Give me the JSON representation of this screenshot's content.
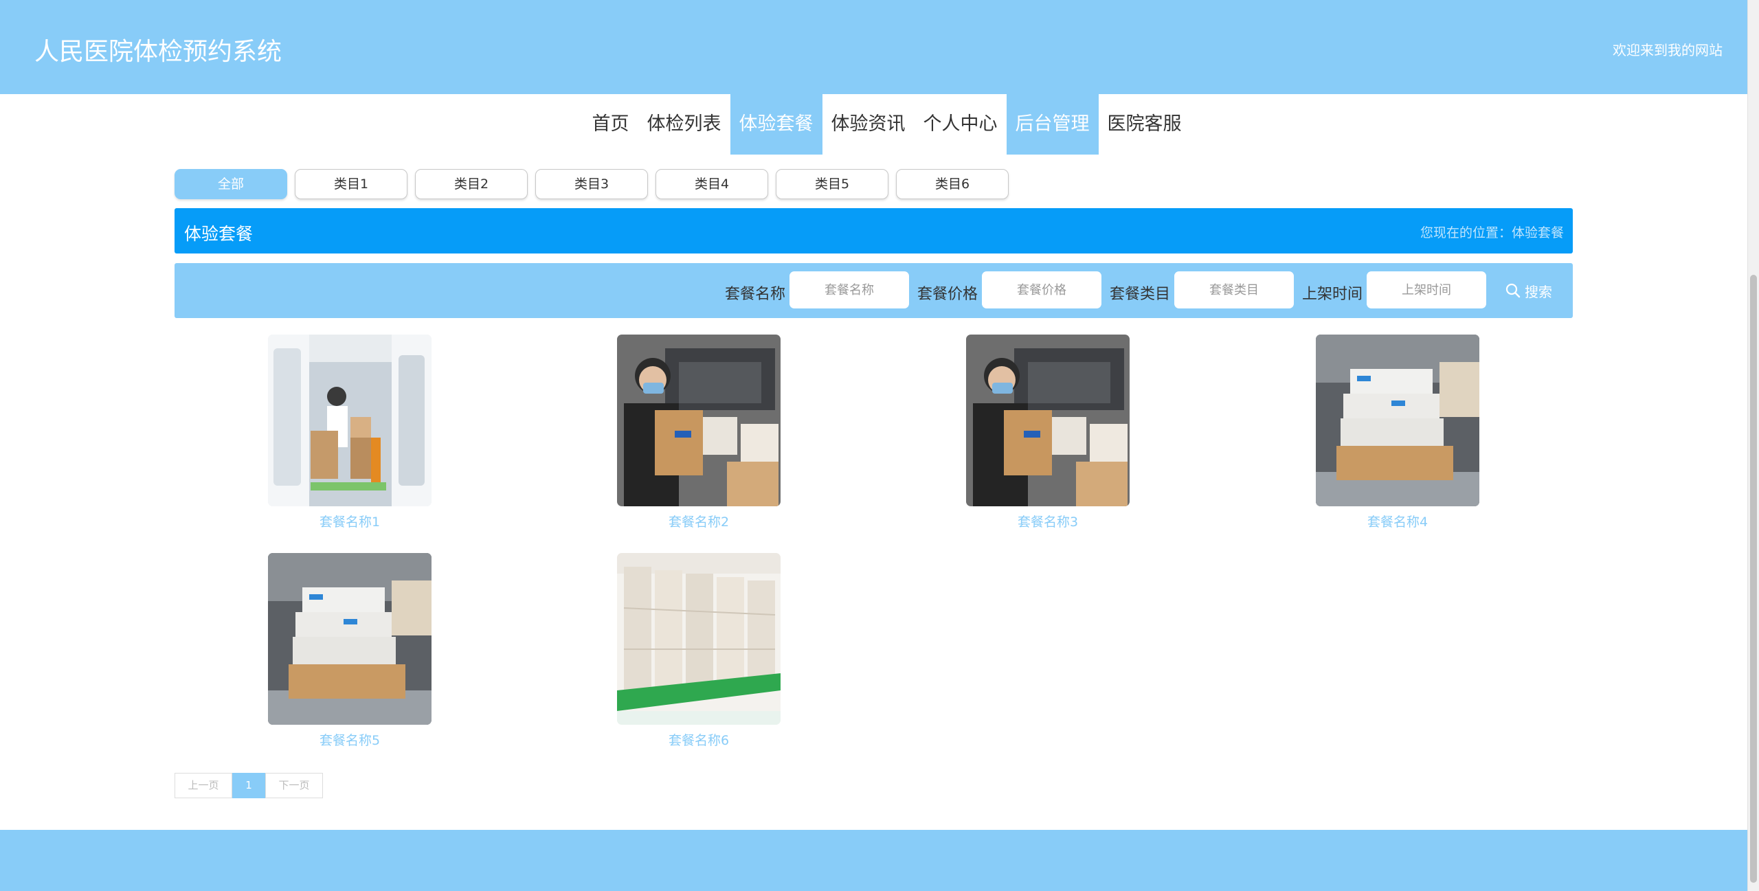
{
  "header": {
    "site_title": "人民医院体检预约系统",
    "welcome": "欢迎来到我的网站"
  },
  "nav": {
    "items": [
      {
        "label": "首页",
        "active": false
      },
      {
        "label": "体检列表",
        "active": false
      },
      {
        "label": "体验套餐",
        "active": true
      },
      {
        "label": "体验资讯",
        "active": false
      },
      {
        "label": "个人中心",
        "active": false
      },
      {
        "label": "后台管理",
        "active": true
      },
      {
        "label": "医院客服",
        "active": false
      }
    ]
  },
  "categories": [
    {
      "label": "全部",
      "active": true
    },
    {
      "label": "类目1",
      "active": false
    },
    {
      "label": "类目2",
      "active": false
    },
    {
      "label": "类目3",
      "active": false
    },
    {
      "label": "类目4",
      "active": false
    },
    {
      "label": "类目5",
      "active": false
    },
    {
      "label": "类目6",
      "active": false
    }
  ],
  "title_bar": {
    "title": "体验套餐",
    "location": "您现在的位置：体验套餐"
  },
  "search": {
    "fields": [
      {
        "label": "套餐名称",
        "placeholder": "套餐名称",
        "value": ""
      },
      {
        "label": "套餐价格",
        "placeholder": "套餐价格",
        "value": ""
      },
      {
        "label": "套餐类目",
        "placeholder": "套餐类目",
        "value": ""
      },
      {
        "label": "上架时间",
        "placeholder": "上架时间",
        "value": ""
      }
    ],
    "button_label": "搜索"
  },
  "products": [
    {
      "name": "套餐名称1",
      "image": "ambulance-loading-photo"
    },
    {
      "name": "套餐名称2",
      "image": "woman-with-box-car-photo"
    },
    {
      "name": "套餐名称3",
      "image": "woman-with-box-car-photo"
    },
    {
      "name": "套餐名称4",
      "image": "stacked-boxes-warehouse-photo"
    },
    {
      "name": "套餐名称5",
      "image": "stacked-boxes-warehouse-photo"
    },
    {
      "name": "套餐名称6",
      "image": "boxes-on-green-pallets-photo"
    }
  ],
  "pagination": {
    "prev_label": "上一页",
    "current": "1",
    "next_label": "下一页"
  },
  "colors": {
    "primary": "#88ccf8",
    "title_bar": "#069cf8"
  }
}
